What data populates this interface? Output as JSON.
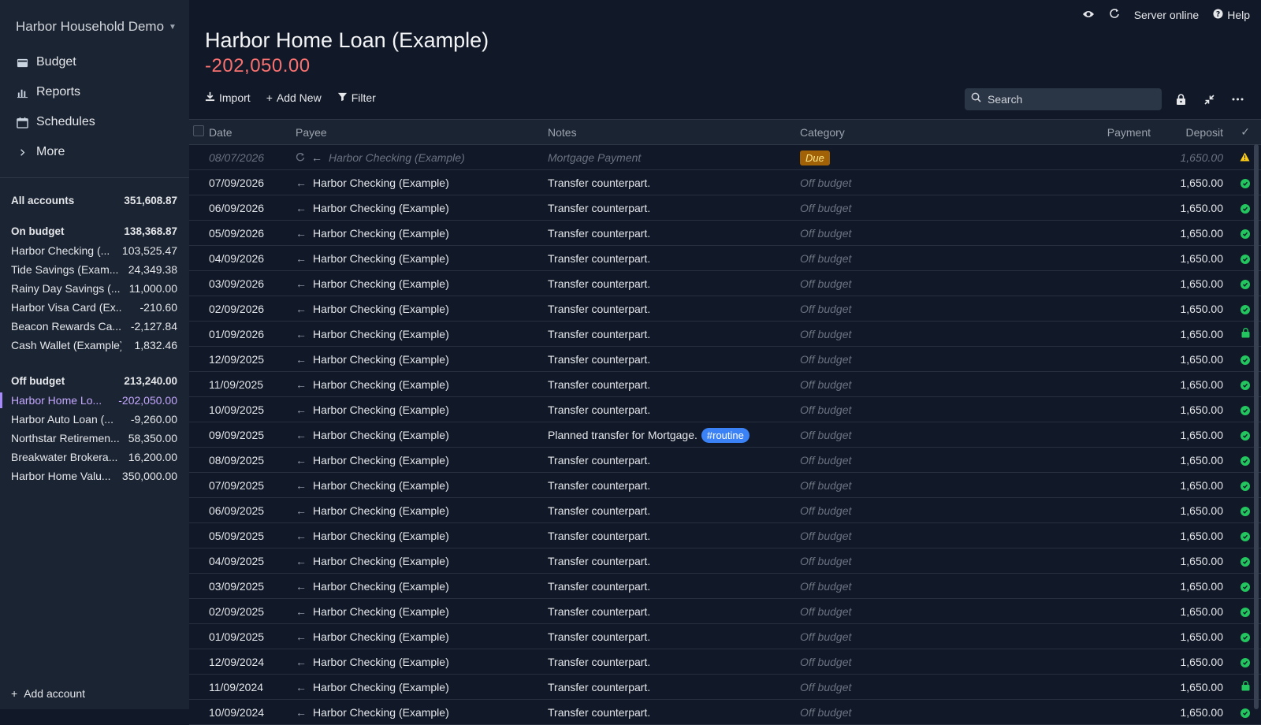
{
  "budget_name": "Harbor Household Demo",
  "nav": [
    {
      "label": "Budget",
      "icon": "wallet-icon"
    },
    {
      "label": "Reports",
      "icon": "bar-chart-icon"
    },
    {
      "label": "Schedules",
      "icon": "calendar-icon"
    },
    {
      "label": "More",
      "icon": "chevron-right-icon"
    }
  ],
  "accounts": {
    "all": {
      "name": "All accounts",
      "value": "351,608.87"
    },
    "on_budget": {
      "name": "On budget",
      "value": "138,368.87"
    },
    "on_budget_items": [
      {
        "name": "Harbor Checking (...",
        "value": "103,525.47"
      },
      {
        "name": "Tide Savings (Exam...",
        "value": "24,349.38"
      },
      {
        "name": "Rainy Day Savings (...",
        "value": "11,000.00"
      },
      {
        "name": "Harbor Visa Card (Ex...",
        "value": "-210.60"
      },
      {
        "name": "Beacon Rewards Ca...",
        "value": "-2,127.84"
      },
      {
        "name": "Cash Wallet (Example)",
        "value": "1,832.46"
      }
    ],
    "off_budget": {
      "name": "Off budget",
      "value": "213,240.00"
    },
    "off_budget_items": [
      {
        "name": "Harbor Home Lo...",
        "value": "-202,050.00"
      },
      {
        "name": "Harbor Auto Loan (...",
        "value": "-9,260.00"
      },
      {
        "name": "Northstar Retiremen...",
        "value": "58,350.00"
      },
      {
        "name": "Breakwater Brokera...",
        "value": "16,200.00"
      },
      {
        "name": "Harbor Home Valu...",
        "value": "350,000.00"
      }
    ]
  },
  "add_account": "Add account",
  "topbar": {
    "server_status": "Server online",
    "help": "Help"
  },
  "account": {
    "title": "Harbor Home Loan (Example)",
    "balance": "-202,050.00"
  },
  "toolbar": {
    "import": "Import",
    "add_new": "Add New",
    "filter": "Filter",
    "search_placeholder": "Search"
  },
  "columns": {
    "date": "Date",
    "payee": "Payee",
    "notes": "Notes",
    "category": "Category",
    "payment": "Payment",
    "deposit": "Deposit",
    "cleared": "✓"
  },
  "colors": {
    "accent": "#a78bfa",
    "negative": "#f87171",
    "cleared": "#22c55e",
    "due": "#a16207",
    "tag": "#3b82f6"
  },
  "rows": [
    {
      "date": "08/07/2026",
      "payee": "Harbor Checking (Example)",
      "notes": "Mortgage Payment",
      "category": "Due",
      "deposit": "1,650.00",
      "status": "warning",
      "scheduled": true
    },
    {
      "date": "07/09/2026",
      "payee": "Harbor Checking (Example)",
      "notes": "Transfer counterpart.",
      "category": "Off budget",
      "deposit": "1,650.00",
      "status": "cleared"
    },
    {
      "date": "06/09/2026",
      "payee": "Harbor Checking (Example)",
      "notes": "Transfer counterpart.",
      "category": "Off budget",
      "deposit": "1,650.00",
      "status": "cleared"
    },
    {
      "date": "05/09/2026",
      "payee": "Harbor Checking (Example)",
      "notes": "Transfer counterpart.",
      "category": "Off budget",
      "deposit": "1,650.00",
      "status": "cleared"
    },
    {
      "date": "04/09/2026",
      "payee": "Harbor Checking (Example)",
      "notes": "Transfer counterpart.",
      "category": "Off budget",
      "deposit": "1,650.00",
      "status": "cleared"
    },
    {
      "date": "03/09/2026",
      "payee": "Harbor Checking (Example)",
      "notes": "Transfer counterpart.",
      "category": "Off budget",
      "deposit": "1,650.00",
      "status": "cleared"
    },
    {
      "date": "02/09/2026",
      "payee": "Harbor Checking (Example)",
      "notes": "Transfer counterpart.",
      "category": "Off budget",
      "deposit": "1,650.00",
      "status": "cleared"
    },
    {
      "date": "01/09/2026",
      "payee": "Harbor Checking (Example)",
      "notes": "Transfer counterpart.",
      "category": "Off budget",
      "deposit": "1,650.00",
      "status": "locked"
    },
    {
      "date": "12/09/2025",
      "payee": "Harbor Checking (Example)",
      "notes": "Transfer counterpart.",
      "category": "Off budget",
      "deposit": "1,650.00",
      "status": "cleared"
    },
    {
      "date": "11/09/2025",
      "payee": "Harbor Checking (Example)",
      "notes": "Transfer counterpart.",
      "category": "Off budget",
      "deposit": "1,650.00",
      "status": "cleared"
    },
    {
      "date": "10/09/2025",
      "payee": "Harbor Checking (Example)",
      "notes": "Transfer counterpart.",
      "category": "Off budget",
      "deposit": "1,650.00",
      "status": "cleared"
    },
    {
      "date": "09/09/2025",
      "payee": "Harbor Checking (Example)",
      "notes": "Planned transfer for Mortgage.",
      "tag": "#routine",
      "category": "Off budget",
      "deposit": "1,650.00",
      "status": "cleared"
    },
    {
      "date": "08/09/2025",
      "payee": "Harbor Checking (Example)",
      "notes": "Transfer counterpart.",
      "category": "Off budget",
      "deposit": "1,650.00",
      "status": "cleared"
    },
    {
      "date": "07/09/2025",
      "payee": "Harbor Checking (Example)",
      "notes": "Transfer counterpart.",
      "category": "Off budget",
      "deposit": "1,650.00",
      "status": "cleared"
    },
    {
      "date": "06/09/2025",
      "payee": "Harbor Checking (Example)",
      "notes": "Transfer counterpart.",
      "category": "Off budget",
      "deposit": "1,650.00",
      "status": "cleared"
    },
    {
      "date": "05/09/2025",
      "payee": "Harbor Checking (Example)",
      "notes": "Transfer counterpart.",
      "category": "Off budget",
      "deposit": "1,650.00",
      "status": "cleared"
    },
    {
      "date": "04/09/2025",
      "payee": "Harbor Checking (Example)",
      "notes": "Transfer counterpart.",
      "category": "Off budget",
      "deposit": "1,650.00",
      "status": "cleared"
    },
    {
      "date": "03/09/2025",
      "payee": "Harbor Checking (Example)",
      "notes": "Transfer counterpart.",
      "category": "Off budget",
      "deposit": "1,650.00",
      "status": "cleared"
    },
    {
      "date": "02/09/2025",
      "payee": "Harbor Checking (Example)",
      "notes": "Transfer counterpart.",
      "category": "Off budget",
      "deposit": "1,650.00",
      "status": "cleared"
    },
    {
      "date": "01/09/2025",
      "payee": "Harbor Checking (Example)",
      "notes": "Transfer counterpart.",
      "category": "Off budget",
      "deposit": "1,650.00",
      "status": "cleared"
    },
    {
      "date": "12/09/2024",
      "payee": "Harbor Checking (Example)",
      "notes": "Transfer counterpart.",
      "category": "Off budget",
      "deposit": "1,650.00",
      "status": "cleared"
    },
    {
      "date": "11/09/2024",
      "payee": "Harbor Checking (Example)",
      "notes": "Transfer counterpart.",
      "category": "Off budget",
      "deposit": "1,650.00",
      "status": "locked"
    },
    {
      "date": "10/09/2024",
      "payee": "Harbor Checking (Example)",
      "notes": "Transfer counterpart.",
      "category": "Off budget",
      "deposit": "1,650.00",
      "status": "cleared"
    }
  ]
}
